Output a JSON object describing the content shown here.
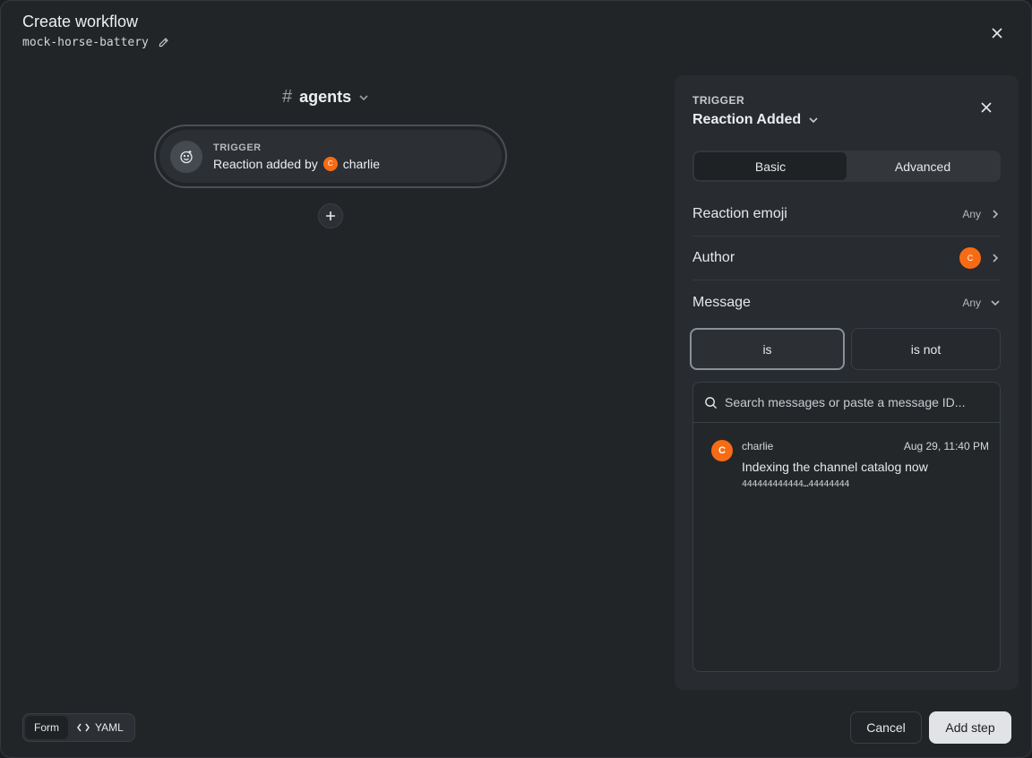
{
  "header": {
    "title": "Create workflow",
    "slug": "mock-horse-battery"
  },
  "canvas": {
    "channel": "agents",
    "trigger_node": {
      "label": "TRIGGER",
      "text": "Reaction added by",
      "user": "charlie",
      "user_initial": "C"
    }
  },
  "panel": {
    "label": "TRIGGER",
    "title": "Reaction Added",
    "tabs": [
      "Basic",
      "Advanced"
    ],
    "active_tab": "Basic",
    "rows": {
      "reaction_emoji": {
        "label": "Reaction emoji",
        "value": "Any"
      },
      "author": {
        "label": "Author",
        "avatar_initial": "C"
      },
      "message": {
        "label": "Message",
        "value": "Any"
      }
    },
    "match_options": [
      "is",
      "is not"
    ],
    "selected_match": "is",
    "search": {
      "placeholder": "Search messages or paste a message ID..."
    },
    "messages": [
      {
        "author": "charlie",
        "initial": "C",
        "time": "Aug 29, 11:40 PM",
        "text": "Indexing the channel catalog now",
        "id": "444444444444…44444444"
      }
    ]
  },
  "footer": {
    "form_label": "Form",
    "yaml_label": "YAML",
    "active_mode": "Form",
    "cancel_label": "Cancel",
    "add_label": "Add step"
  },
  "colors": {
    "accent_avatar": "#f76b15",
    "primary_button": "#e1e3e6",
    "background": "#222528"
  }
}
